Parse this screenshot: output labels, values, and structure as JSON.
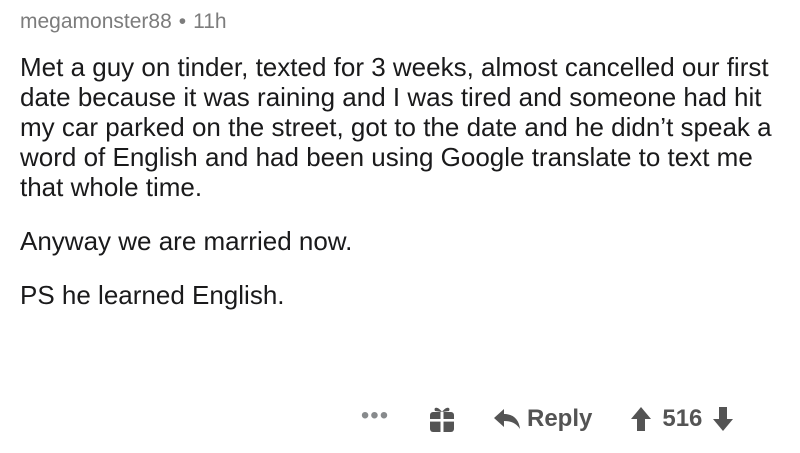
{
  "comment": {
    "username": "megamonster88",
    "separator": "•",
    "time_ago": "11h",
    "paragraphs": [
      "Met a guy on tinder, texted for 3 weeks, almost cancelled our first date because it was raining and I was tired and someone had hit my car parked on the street, got to the date and he didn’t speak a word of English and had been using Google translate to text me that whole time.",
      "Anyway we are married now.",
      "PS he learned English."
    ]
  },
  "actions": {
    "more_label": "•••",
    "reply_label": "Reply",
    "vote_count": "516"
  },
  "icons": {
    "more": "more-options-icon",
    "gift": "gift-icon",
    "reply": "reply-arrow-icon",
    "upvote": "upvote-arrow-icon",
    "downvote": "downvote-arrow-icon"
  },
  "colors": {
    "meta_text": "#7c7c7c",
    "body_text": "#1a1a1b",
    "action_gray": "#545454"
  }
}
